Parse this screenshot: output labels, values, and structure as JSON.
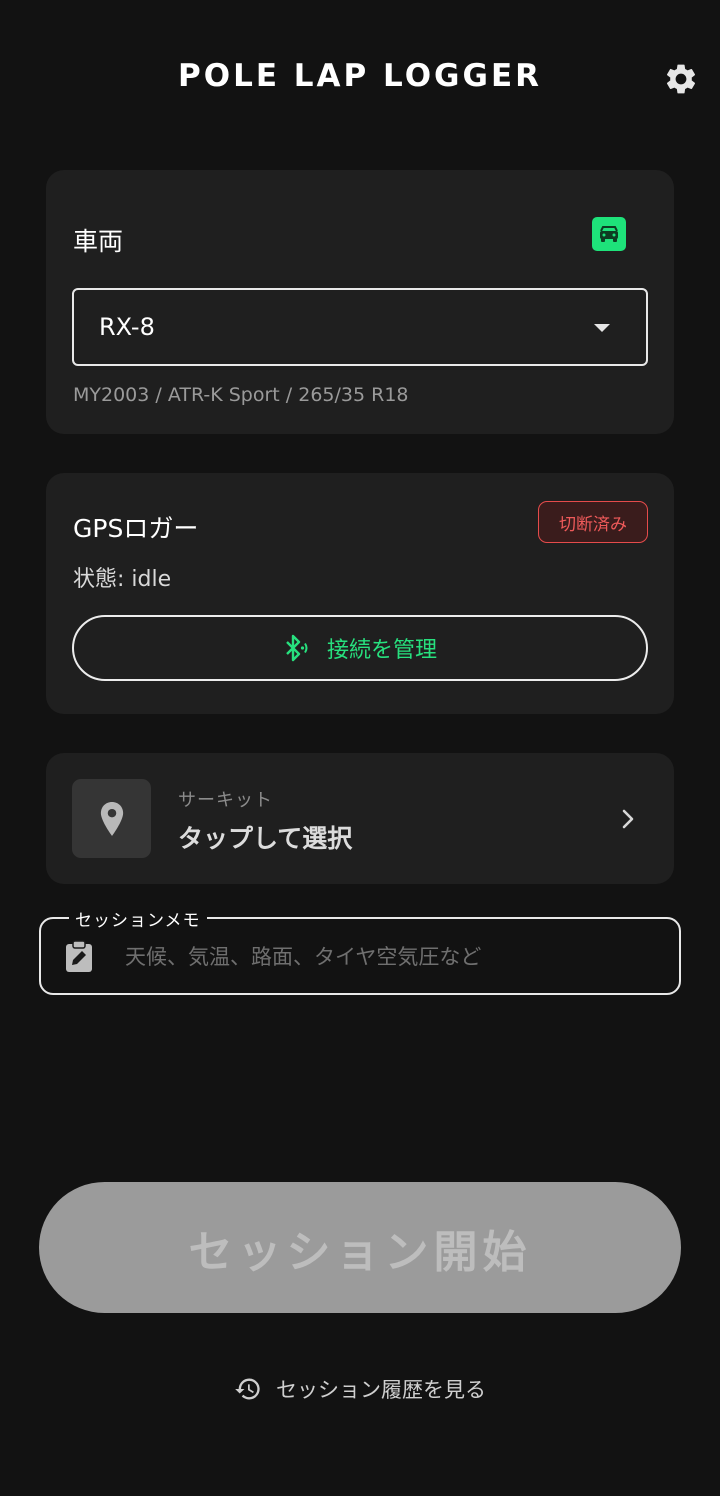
{
  "header": {
    "title": "POLE LAP LOGGER",
    "settings_icon": "gear-icon"
  },
  "vehicle": {
    "label": "車両",
    "icon": "car-icon",
    "selected": "RX-8",
    "spec": "MY2003 / ATR-K Sport / 265/35 R18",
    "accent_color": "#1ee27a"
  },
  "gps": {
    "title": "GPSロガー",
    "status_badge": "切断済み",
    "status_badge_color": "#e54b4b",
    "status_text": "状態: idle",
    "manage_button": "接続を管理",
    "manage_icon": "bluetooth-searching-icon",
    "accent_color": "#27e07e"
  },
  "circuit": {
    "caption": "サーキット",
    "value": "タップして選択",
    "icon": "location-pin-icon"
  },
  "memo": {
    "label": "セッションメモ",
    "placeholder": "天候、気温、路面、タイヤ空気圧など",
    "icon": "clipboard-edit-icon"
  },
  "start_button": {
    "label": "セッション開始"
  },
  "history": {
    "label": "セッション履歴を見る",
    "icon": "history-icon"
  }
}
